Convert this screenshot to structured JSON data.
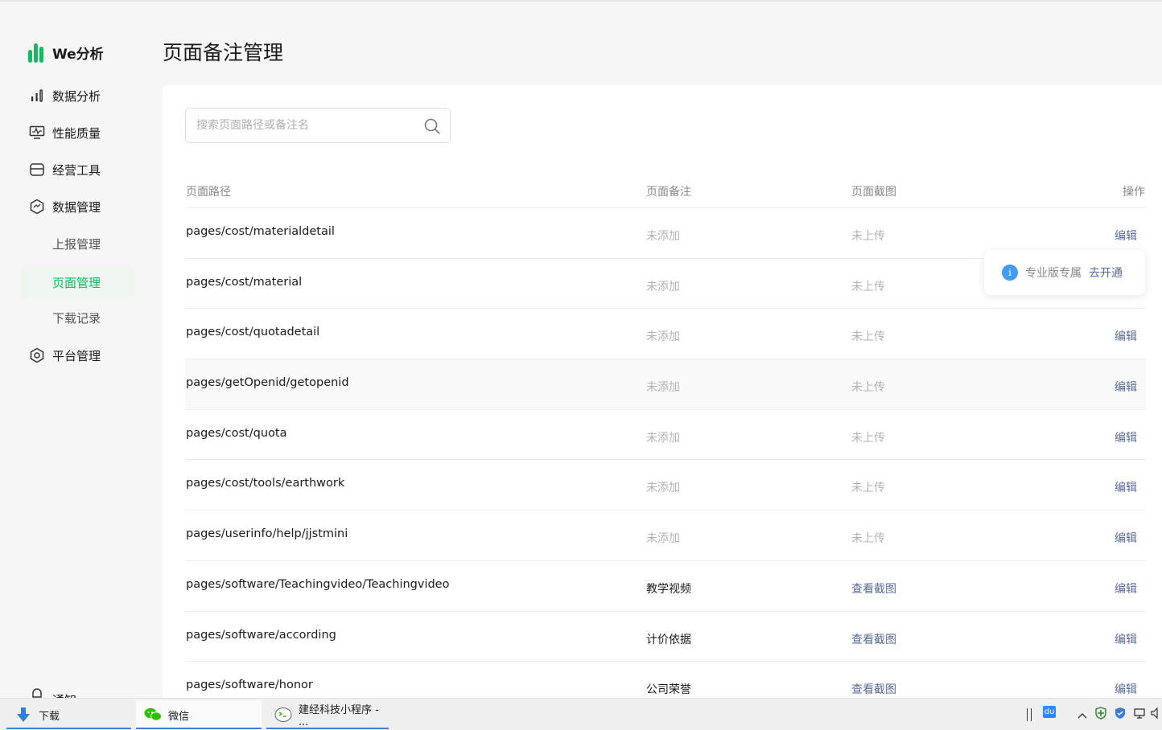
{
  "app": {
    "logo_text": "We分析",
    "brand_color": "#07c160"
  },
  "sidebar": {
    "items": [
      {
        "label": "数据分析",
        "icon": "bar-chart-icon"
      },
      {
        "label": "性能质量",
        "icon": "monitor-icon"
      },
      {
        "label": "经营工具",
        "icon": "store-icon"
      },
      {
        "label": "数据管理",
        "icon": "data-hex-icon"
      },
      {
        "label": "上报管理"
      },
      {
        "label": "页面管理",
        "active": true
      },
      {
        "label": "下载记录"
      },
      {
        "label": "平台管理",
        "icon": "settings-hex-icon"
      }
    ],
    "notice_label": "通知"
  },
  "page": {
    "title": "页面备注管理"
  },
  "search": {
    "placeholder": "搜索页面路径或备注名"
  },
  "table": {
    "headers": {
      "path": "页面路径",
      "note": "页面备注",
      "screenshot": "页面截图",
      "action": "操作"
    },
    "rows": [
      {
        "path": "pages/cost/materialdetail",
        "note": "未添加",
        "screenshot": "未上传",
        "action": "编辑"
      },
      {
        "path": "pages/cost/material",
        "note": "未添加",
        "screenshot": "未上传",
        "action": ""
      },
      {
        "path": "pages/cost/quotadetail",
        "note": "未添加",
        "screenshot": "未上传",
        "action": "编辑"
      },
      {
        "path": "pages/getOpenid/getopenid",
        "note": "未添加",
        "screenshot": "未上传",
        "action": "编辑"
      },
      {
        "path": "pages/cost/quota",
        "note": "未添加",
        "screenshot": "未上传",
        "action": "编辑"
      },
      {
        "path": "pages/cost/tools/earthwork",
        "note": "未添加",
        "screenshot": "未上传",
        "action": "编辑"
      },
      {
        "path": "pages/userinfo/help/jjstmini",
        "note": "未添加",
        "screenshot": "未上传",
        "action": "编辑"
      },
      {
        "path": "pages/software/Teachingvideo/Teachingvideo",
        "note": "教学视频",
        "screenshot": "查看截图",
        "action": "编辑"
      },
      {
        "path": "pages/software/according",
        "note": "计价依据",
        "screenshot": "查看截图",
        "action": "编辑"
      },
      {
        "path": "pages/software/honor",
        "note": "公司荣誉",
        "screenshot": "查看截图",
        "action": "编辑"
      }
    ]
  },
  "pro_tip": {
    "icon_glyph": "i",
    "text": "专业版专属",
    "link": "去开通"
  },
  "taskbar": {
    "items": [
      {
        "label": "下载",
        "icon": "download-arrow-icon"
      },
      {
        "label": "微信",
        "icon": "wechat-icon"
      },
      {
        "label": "建经科技小程序 - ...",
        "icon": "devtools-icon"
      }
    ],
    "tray_badge": "du"
  }
}
